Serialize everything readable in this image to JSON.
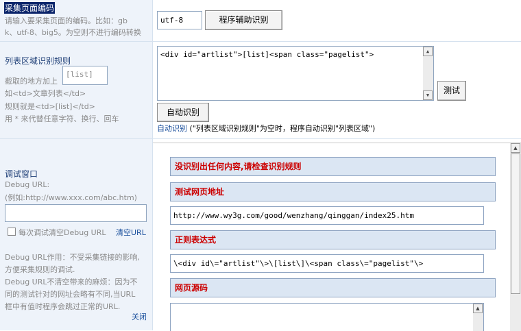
{
  "section1": {
    "title": "采集页面编码",
    "desc_line1": "请输入要采集页面的编码。比如：gb",
    "desc_line2": "k、utf-8、big5。为空则不进行编码转换",
    "encoding_value": "utf-8",
    "assist_button": "程序辅助识别"
  },
  "section2": {
    "title": "列表区域识别规则",
    "desc_prefix": "截取的地方加上",
    "list_placeholder": "[list]",
    "desc_line2": "如<td>文章列表</td>",
    "desc_line3": "规则就是<td>[list]</td>",
    "desc_line4": "用 * 来代替任意字符、换行、回车",
    "rule_value": "<div id=\"artlist\">[list]<span class=\"pagelist\">",
    "test_button": "测试",
    "auto_button": "自动识别",
    "auto_link": "自动识别",
    "auto_note": "(\"列表区域识别规则\"为空时，程序自动识别\"列表区域\")"
  },
  "section3": {
    "title": "调试窗口",
    "debug_url_label": "Debug URL:",
    "debug_url_example": "(例如:http://www.xxx.com/abc.htm)",
    "debug_url_value": "",
    "clear_each_label": "每次调试清空Debug URL",
    "clear_link": "清空URL",
    "note1_line1": "Debug URL作用：不受采集链接的影响,",
    "note1_line2": "方便采集规则的调试.",
    "note2_line1": "Debug URL不清空带来的麻烦：因为不",
    "note2_line2": "同的测试针对的网址会略有不同,当URL",
    "note2_line3": "框中有值时程序会跳过正常的URL.",
    "close_link": "关闭"
  },
  "debug_panel": {
    "error_msg": "没识别出任何内容,请检查识别规则",
    "test_url_heading": "测试网页地址",
    "test_url_value": "http://www.wy3g.com/good/wenzhang/qinggan/index25.htm",
    "regex_heading": "正则表达式",
    "regex_value": "\\<div id\\=\"artlist\"\\>\\[list\\]\\<span class\\=\"pagelist\"\\>",
    "source_heading": "网页源码"
  },
  "colors": {
    "left_bg": "#eef3fa",
    "border": "#d6e2ef",
    "bar_bg": "#dbe6f3",
    "error_red": "#cc0000",
    "title_blue": "#1f3f77"
  }
}
